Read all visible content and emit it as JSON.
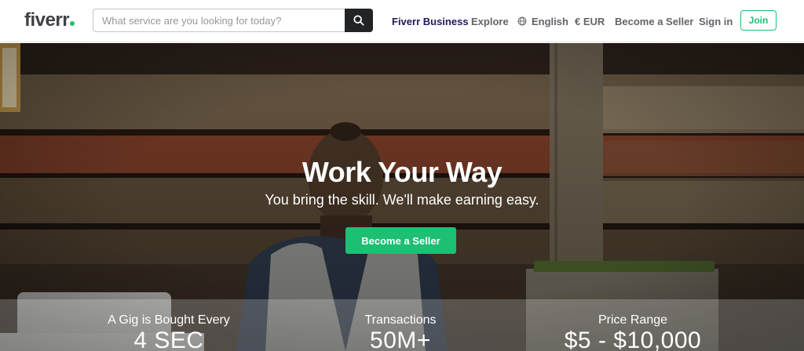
{
  "header": {
    "logo": "fiverr",
    "search": {
      "placeholder": "What service are you looking for today?",
      "icon": "search-icon"
    },
    "nav": {
      "business": "Fiverr Business",
      "explore": "Explore",
      "language": "English",
      "language_icon": "globe-icon",
      "currency": "€ EUR",
      "become_seller": "Become a Seller",
      "sign_in": "Sign in",
      "join": "Join"
    }
  },
  "hero": {
    "title": "Work Your Way",
    "subtitle": "You bring the skill. We'll make earning easy.",
    "cta": "Become a Seller"
  },
  "stats": [
    {
      "label": "A Gig is Bought Every",
      "value": "4 SEC"
    },
    {
      "label": "Transactions",
      "value": "50M+"
    },
    {
      "label": "Price Range",
      "value": "$5 - $10,000"
    }
  ],
  "colors": {
    "brand_green": "#1dbf73",
    "business_navy": "#1f1a59",
    "text_gray": "#62646a"
  }
}
